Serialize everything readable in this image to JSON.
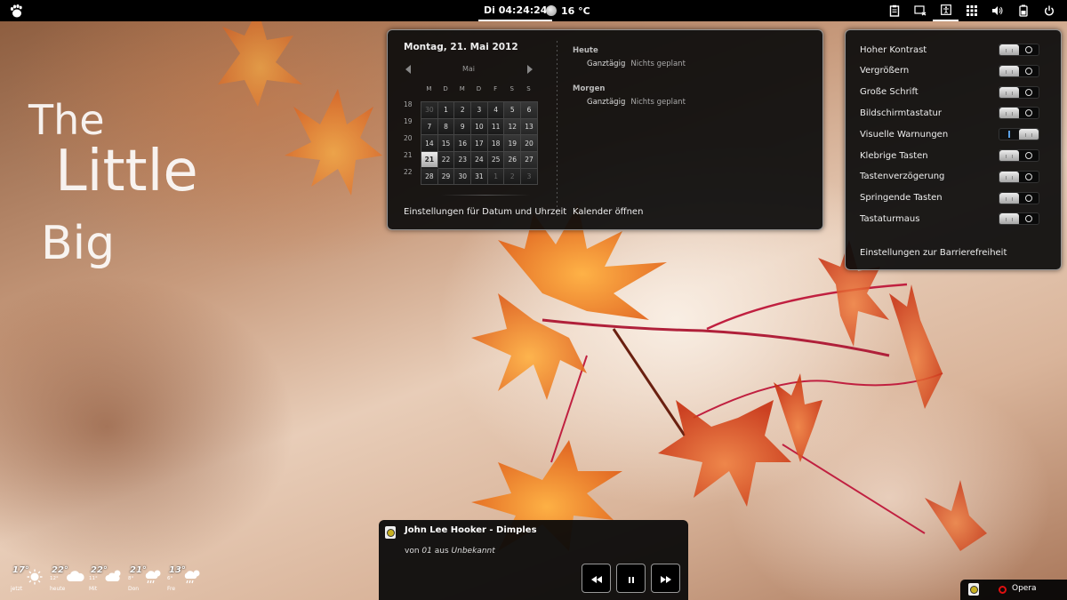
{
  "topbar": {
    "clock": "Di 04:24:24",
    "temperature": "16 °C",
    "tray_icons": [
      "clipboard-icon",
      "display-icon",
      "accessibility-icon",
      "grid-icon",
      "volume-icon",
      "battery-icon",
      "power-icon"
    ]
  },
  "wallpaper_text": {
    "line1": "The",
    "line2": "Little",
    "line3": "Big"
  },
  "calendar": {
    "date_heading": "Montag, 21. Mai 2012",
    "month": "Mai",
    "weekdays": [
      "M",
      "D",
      "M",
      "D",
      "F",
      "S",
      "S"
    ],
    "week_numbers": [
      "18",
      "19",
      "20",
      "21",
      "22"
    ],
    "days": [
      {
        "n": "30",
        "other": true
      },
      {
        "n": "1"
      },
      {
        "n": "2"
      },
      {
        "n": "3"
      },
      {
        "n": "4"
      },
      {
        "n": "5",
        "weekend": true
      },
      {
        "n": "6",
        "weekend": true
      },
      {
        "n": "7"
      },
      {
        "n": "8"
      },
      {
        "n": "9"
      },
      {
        "n": "10"
      },
      {
        "n": "11"
      },
      {
        "n": "12",
        "weekend": true
      },
      {
        "n": "13",
        "weekend": true
      },
      {
        "n": "14"
      },
      {
        "n": "15"
      },
      {
        "n": "16"
      },
      {
        "n": "17"
      },
      {
        "n": "18"
      },
      {
        "n": "19",
        "weekend": true
      },
      {
        "n": "20",
        "weekend": true
      },
      {
        "n": "21",
        "today": true
      },
      {
        "n": "22"
      },
      {
        "n": "23"
      },
      {
        "n": "24"
      },
      {
        "n": "25"
      },
      {
        "n": "26",
        "weekend": true
      },
      {
        "n": "27",
        "weekend": true
      },
      {
        "n": "28"
      },
      {
        "n": "29"
      },
      {
        "n": "30"
      },
      {
        "n": "31"
      },
      {
        "n": "1",
        "other": true
      },
      {
        "n": "2",
        "other": true
      },
      {
        "n": "3",
        "other": true
      }
    ],
    "today_heading": "Heute",
    "today_event_time": "Ganztägig",
    "today_event_text": "Nichts geplant",
    "tomorrow_heading": "Morgen",
    "tomorrow_event_time": "Ganztägig",
    "tomorrow_event_text": "Nichts geplant",
    "settings_link": "Einstellungen für Datum und Uhrzeit",
    "open_calendar": "Kalender öffnen"
  },
  "accessibility": {
    "items": [
      {
        "label": "Hoher Kontrast",
        "on": false
      },
      {
        "label": "Vergrößern",
        "on": false
      },
      {
        "label": "Große Schrift",
        "on": false
      },
      {
        "label": "Bildschirmtastatur",
        "on": false
      },
      {
        "label": "Visuelle Warnungen",
        "on": true
      },
      {
        "label": "Klebrige Tasten",
        "on": false
      },
      {
        "label": "Tastenverzögerung",
        "on": false
      },
      {
        "label": "Springende Tasten",
        "on": false
      },
      {
        "label": "Tastaturmaus",
        "on": false
      }
    ],
    "settings_link": "Einstellungen zur Barrierefreiheit"
  },
  "player": {
    "track": "John Lee Hooker - Dimples",
    "sub_prefix": "von",
    "artist": "01",
    "sub_mid": "aus",
    "album": "Unbekannt"
  },
  "message_tray": {
    "app_label": "Opera"
  },
  "forecast": [
    {
      "temp": "17°",
      "low": "",
      "day": "jetzt",
      "icon": "sun-icon"
    },
    {
      "temp": "22°",
      "low": "12°",
      "day": "heute",
      "icon": "cloud-icon"
    },
    {
      "temp": "22°",
      "low": "11°",
      "day": "Mit",
      "icon": "sun-cloud-icon"
    },
    {
      "temp": "21°",
      "low": "8°",
      "day": "Don",
      "icon": "rain-sun-icon"
    },
    {
      "temp": "13°",
      "low": "6°",
      "day": "Fre",
      "icon": "rain-sun-icon"
    }
  ],
  "colors": {
    "toggle_on_accent": "#5aa0e6",
    "today_highlight": "#eeeeee"
  }
}
